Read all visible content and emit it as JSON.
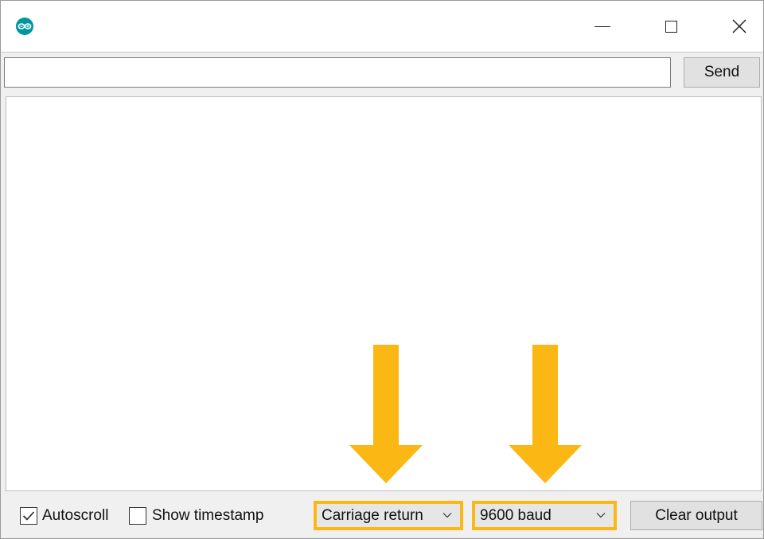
{
  "window": {
    "app_icon": "arduino-logo-icon",
    "controls": {
      "minimize_icon": "minimize-icon",
      "maximize_icon": "maximize-icon",
      "close_icon": "close-icon"
    }
  },
  "send_bar": {
    "input_value": "",
    "send_label": "Send"
  },
  "output": {
    "text": ""
  },
  "bottom_bar": {
    "autoscroll": {
      "label": "Autoscroll",
      "checked": true
    },
    "show_timestamp": {
      "label": "Show timestamp",
      "checked": false
    },
    "line_ending": {
      "selected": "Carriage return"
    },
    "baud_rate": {
      "selected": "9600 baud"
    },
    "clear_label": "Clear output"
  },
  "annotations": {
    "arrow_color": "#fbb714",
    "highlight_color": "#fbb714"
  },
  "colors": {
    "arduino_teal": "#00979c"
  }
}
